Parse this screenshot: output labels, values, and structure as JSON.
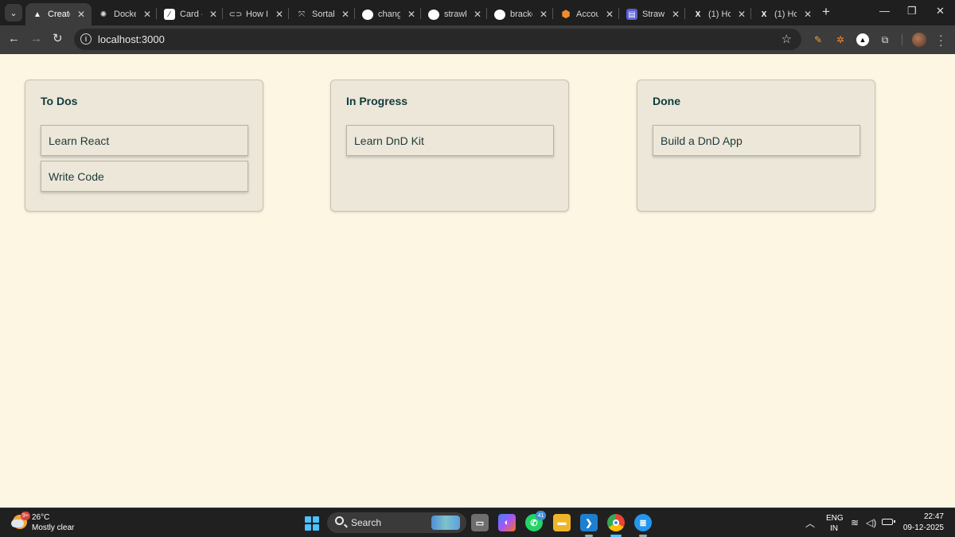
{
  "browser": {
    "tabs": [
      {
        "title": "Create",
        "icon": "vercel-triangle-icon",
        "active": true
      },
      {
        "title": "Docke",
        "icon": "openai-icon"
      },
      {
        "title": "Card -",
        "icon": "shadcn-icon"
      },
      {
        "title": "How I",
        "icon": "tab-generic-icon"
      },
      {
        "title": "Sortab",
        "icon": "dnd-kit-icon"
      },
      {
        "title": "chang",
        "icon": "github-icon"
      },
      {
        "title": "strawk",
        "icon": "github-icon"
      },
      {
        "title": "bracke",
        "icon": "github-icon"
      },
      {
        "title": "Accou",
        "icon": "hexagon-icon"
      },
      {
        "title": "Strawk",
        "icon": "strawk-icon"
      },
      {
        "title": "(1) Ho",
        "icon": "x-icon"
      },
      {
        "title": "(1) Ho",
        "icon": "x-icon"
      }
    ],
    "address_bar": {
      "url": "localhost:3000"
    },
    "new_tab_label": "+"
  },
  "board": {
    "columns": [
      {
        "title": "To Dos",
        "cards": [
          "Learn React",
          "Write Code"
        ]
      },
      {
        "title": "In Progress",
        "cards": [
          "Learn DnD Kit"
        ]
      },
      {
        "title": "Done",
        "cards": [
          "Build a DnD App"
        ]
      }
    ]
  },
  "taskbar": {
    "weather": {
      "temp": "26°C",
      "condition": "Mostly clear",
      "badge": "9+"
    },
    "search_placeholder": "Search",
    "whatsapp_badge": "41",
    "language": {
      "line1": "ENG",
      "line2": "IN"
    },
    "clock": {
      "time": "22:47",
      "date": "09-12-2025"
    }
  },
  "colors": {
    "page_background": "#fdf6e3",
    "column_background": "#ede7d9",
    "heading_text": "#0f3b3b",
    "browser_frame": "#1f1f1f",
    "toolbar": "#3c3c3c"
  }
}
